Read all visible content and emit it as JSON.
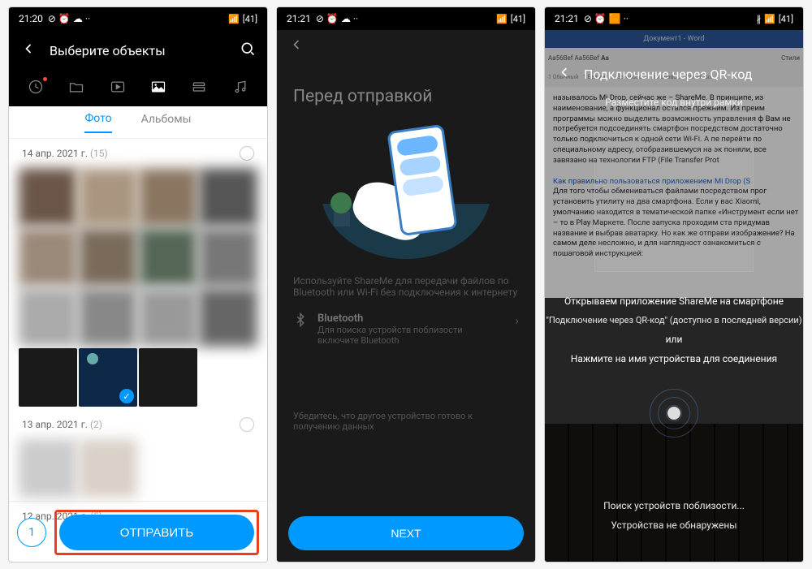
{
  "screen1": {
    "time": "21:20",
    "status_icons": "⊘ ⏰ ☁ ··",
    "signal": "..ıl ⚪ 📶",
    "battery": "41",
    "header_title": "Выберите объекты",
    "toolbar_items": [
      "recent",
      "folder",
      "video",
      "image",
      "archive",
      "music"
    ],
    "tabs": {
      "photo": "Фото",
      "albums": "Альбомы"
    },
    "section1": {
      "date": "14 апр. 2021 г.",
      "count": "(15)"
    },
    "section2": {
      "date": "13 апр. 2021 г.",
      "count": "(2)"
    },
    "section3": {
      "date": "12 апр. 2021 г.",
      "count": "(5)"
    },
    "selected_count": "1",
    "send": "ОТПРАВИТЬ"
  },
  "screen2": {
    "time": "21:21",
    "status_icons": "⊘ ⏰ ☁ ··",
    "battery": "41",
    "title": "Перед отправкой",
    "description": "Используйте ShareMe для передачи файлов по Bluetooth или Wi-Fi без подключения к интернету",
    "bluetooth": {
      "label": "Bluetooth",
      "sub": "Для поиска устройств поблизости включите Bluetooth"
    },
    "hint": "Убедитесь, что другое устройство готово к получению данных",
    "next": "NEXT"
  },
  "screen3": {
    "time": "21:21",
    "status_icons": "⊘ ⏰ 🟧 ··",
    "battery": "41",
    "word_title": "Документ1 - Word",
    "header_title": "Подключение через QR-код",
    "qr_hint": "Разместите код внутри рамки",
    "doc_text": "называлось Mi Drop, сейчас же – ShareMe. В принципе, из наименование, а функционал остался прежним. Из преим программы можно выделить возможность управления ф Вам не потребуется подсоединять смартфон посредством достаточно только подключиться к одной сети Wi-Fi. А пе перейти по специальному адресу, отобразившемуся на эк поняли, все завязано на технологии FTP (File Transfer Prot",
    "doc_link": "Как правильно пользоваться приложением Mi Drop (S",
    "doc_text2": "Для того чтобы обмениваться файлами посредством прог установить утилиту на два смартфона. Если у вас Xiaomi, умолчанию находится в тематической папке «Инструмент если нет – то в Play Маркете. После запуска проходим ста придумав название и выбрав аватарку. Но как же отправи изображение? На самом деле несложно, и для наглядност ознакомиться с пошаговой инструкцией:",
    "discovery_1": "Открываем приложение ShareMe на смартфоне",
    "discovery_2": "\"Подключение через QR-код\" (доступно в последней версии)",
    "or": "или",
    "discovery_3": "Нажмите на имя устройства для соединения",
    "searching": "Поиск устройств поблизости...",
    "not_found": "Устройства не обнаружены"
  }
}
